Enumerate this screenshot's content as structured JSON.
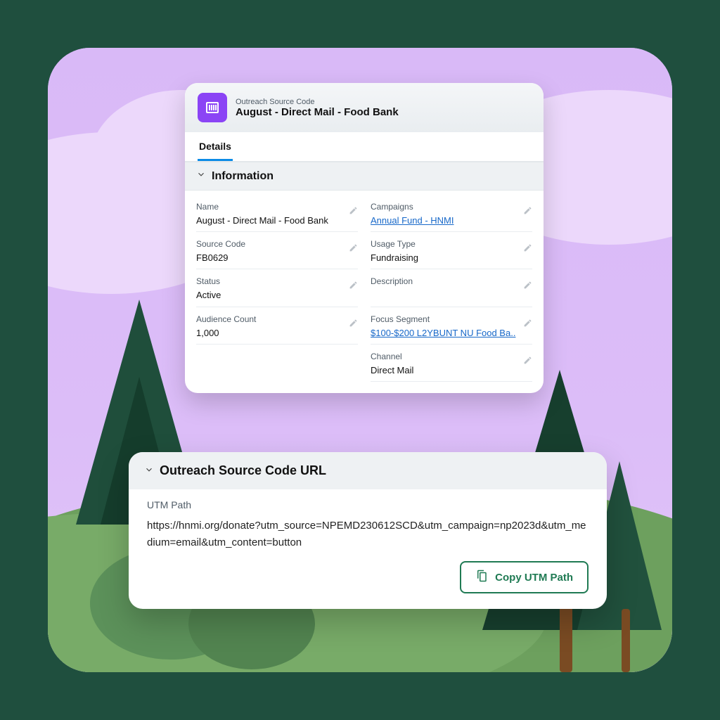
{
  "header": {
    "object": "Outreach Source Code",
    "title": "August - Direct Mail - Food Bank"
  },
  "tabs": {
    "details": "Details"
  },
  "section_info": "Information",
  "fields": {
    "left": [
      {
        "label": "Name",
        "value": "August - Direct Mail - Food Bank",
        "link": false
      },
      {
        "label": "Source Code",
        "value": "FB0629",
        "link": false
      },
      {
        "label": "Status",
        "value": "Active",
        "link": false
      },
      {
        "label": "Audience Count",
        "value": "1,000",
        "link": false
      }
    ],
    "right": [
      {
        "label": "Campaigns",
        "value": "Annual Fund - HNMI",
        "link": true
      },
      {
        "label": "Usage Type",
        "value": "Fundraising",
        "link": false
      },
      {
        "label": "Description",
        "value": "",
        "link": false
      },
      {
        "label": "Focus Segment",
        "value": "$100-$200 L2YBUNT NU Food Ba..",
        "link": true
      },
      {
        "label": "Channel",
        "value": "Direct Mail",
        "link": false
      }
    ]
  },
  "url_panel": {
    "section": "Outreach Source Code URL",
    "label": "UTM Path",
    "url": "https://hnmi.org/donate?utm_source=NPEMD230612SCD&utm_campaign=np2023d&utm_medium=email&utm_content=button",
    "button": "Copy UTM Path"
  }
}
